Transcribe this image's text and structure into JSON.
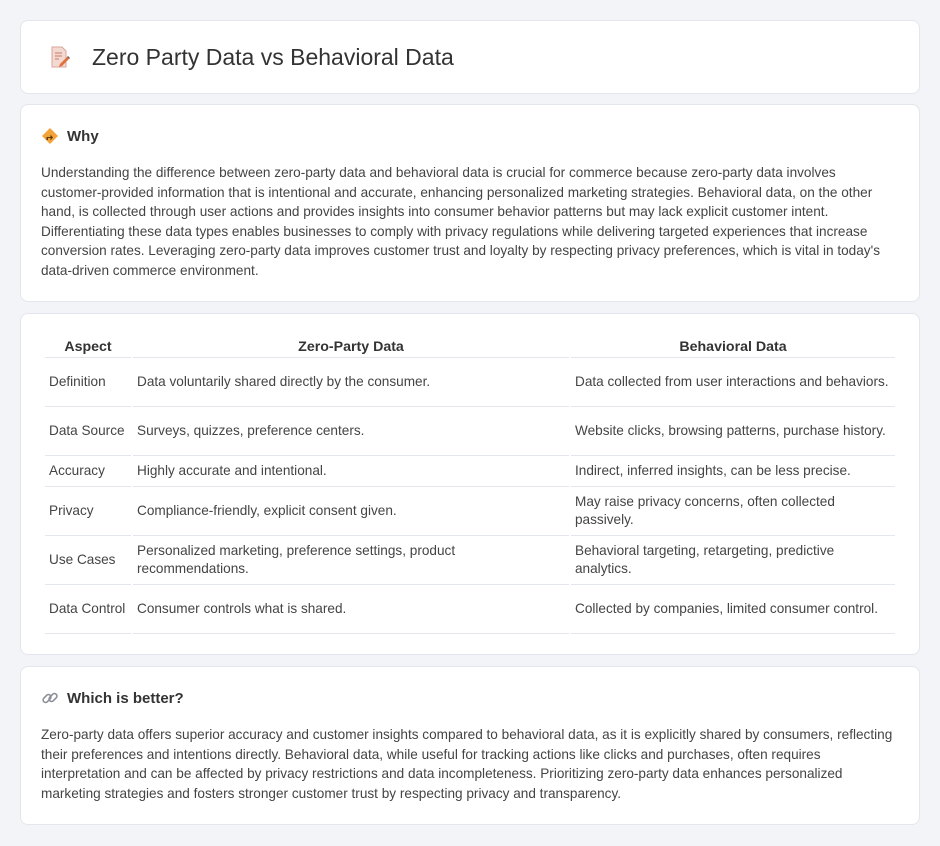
{
  "header": {
    "title": "Zero Party Data vs Behavioral Data"
  },
  "why": {
    "heading": "Why",
    "text": "Understanding the difference between zero-party data and behavioral data is crucial for commerce because zero-party data involves customer-provided information that is intentional and accurate, enhancing personalized marketing strategies. Behavioral data, on the other hand, is collected through user actions and provides insights into consumer behavior patterns but may lack explicit customer intent. Differentiating these data types enables businesses to comply with privacy regulations while delivering targeted experiences that increase conversion rates. Leveraging zero-party data improves customer trust and loyalty by respecting privacy preferences, which is vital in today's data-driven commerce environment."
  },
  "table": {
    "headers": [
      "Aspect",
      "Zero-Party Data",
      "Behavioral Data"
    ],
    "rows": [
      [
        "Definition",
        "Data voluntarily shared directly by the consumer.",
        "Data collected from user interactions and behaviors."
      ],
      [
        "Data Source",
        "Surveys, quizzes, preference centers.",
        "Website clicks, browsing patterns, purchase history."
      ],
      [
        "Accuracy",
        "Highly accurate and intentional.",
        "Indirect, inferred insights, can be less precise."
      ],
      [
        "Privacy",
        "Compliance-friendly, explicit consent given.",
        "May raise privacy concerns, often collected passively."
      ],
      [
        "Use Cases",
        "Personalized marketing, preference settings, product recommendations.",
        "Behavioral targeting, retargeting, predictive analytics."
      ],
      [
        "Data Control",
        "Consumer controls what is shared.",
        "Collected by companies, limited consumer control."
      ]
    ]
  },
  "better": {
    "heading": "Which is better?",
    "text": "Zero-party data offers superior accuracy and customer insights compared to behavioral data, as it is explicitly shared by consumers, reflecting their preferences and intentions directly. Behavioral data, while useful for tracking actions like clicks and purchases, often requires interpretation and can be affected by privacy restrictions and data incompleteness. Prioritizing zero-party data enhances personalized marketing strategies and fosters stronger customer trust by respecting privacy and transparency."
  },
  "icons": {
    "header": "document-pencil-icon",
    "why": "diamond-sign-icon",
    "better": "link-icon"
  }
}
